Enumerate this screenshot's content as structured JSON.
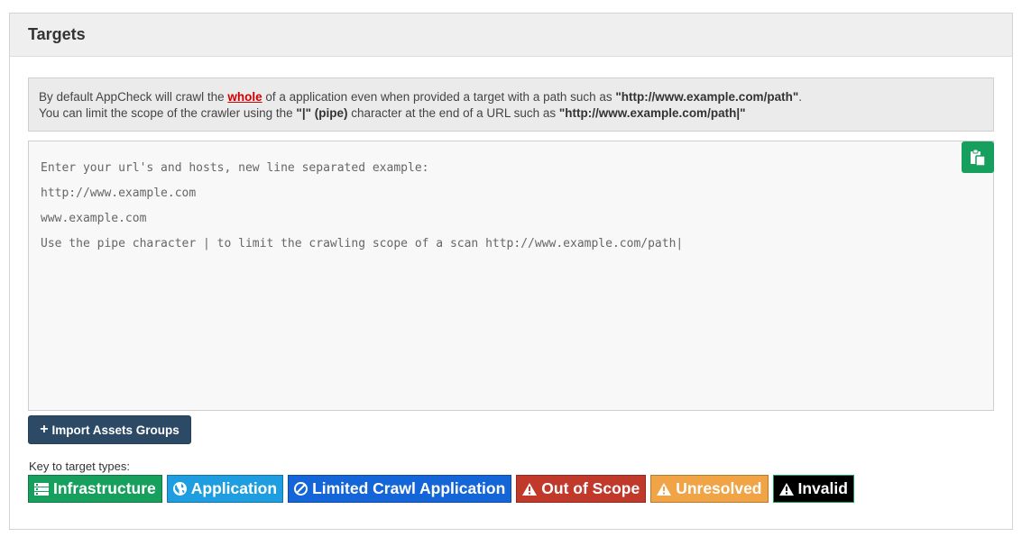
{
  "panel": {
    "title": "Targets"
  },
  "info": {
    "line1_pre": "By default AppCheck will crawl the ",
    "line1_whole": "whole",
    "line1_mid": " of a application even when provided a target with a path such as ",
    "line1_example": "\"http://www.example.com/path\"",
    "line1_end": ".",
    "line2_pre": "You can limit the scope of the crawler using the ",
    "line2_pipe": "\"|\" (pipe)",
    "line2_mid": " character at the end of a URL such as ",
    "line2_example": "\"http://www.example.com/path|\""
  },
  "targets": {
    "placeholder": "Enter your url's and hosts, new line separated example:\nhttp://www.example.com\nwww.example.com\nUse the pipe character | to limit the crawling scope of a scan http://www.example.com/path|"
  },
  "buttons": {
    "import_label": "Import Assets Groups",
    "paste_icon": "clipboard-icon"
  },
  "key": {
    "label": "Key to target types:",
    "types": [
      {
        "label": "Infrastructure",
        "icon": "server-icon",
        "color": "#17a05d"
      },
      {
        "label": "Application",
        "icon": "globe-icon",
        "color": "#1e9de0"
      },
      {
        "label": "Limited Crawl Application",
        "icon": "ban-icon",
        "color": "#1466d8"
      },
      {
        "label": "Out of Scope",
        "icon": "warning-icon",
        "color": "#c0392b"
      },
      {
        "label": "Unresolved",
        "icon": "warning-icon",
        "color": "#f0a445"
      },
      {
        "label": "Invalid",
        "icon": "warning-icon",
        "color": "#000000"
      }
    ]
  }
}
